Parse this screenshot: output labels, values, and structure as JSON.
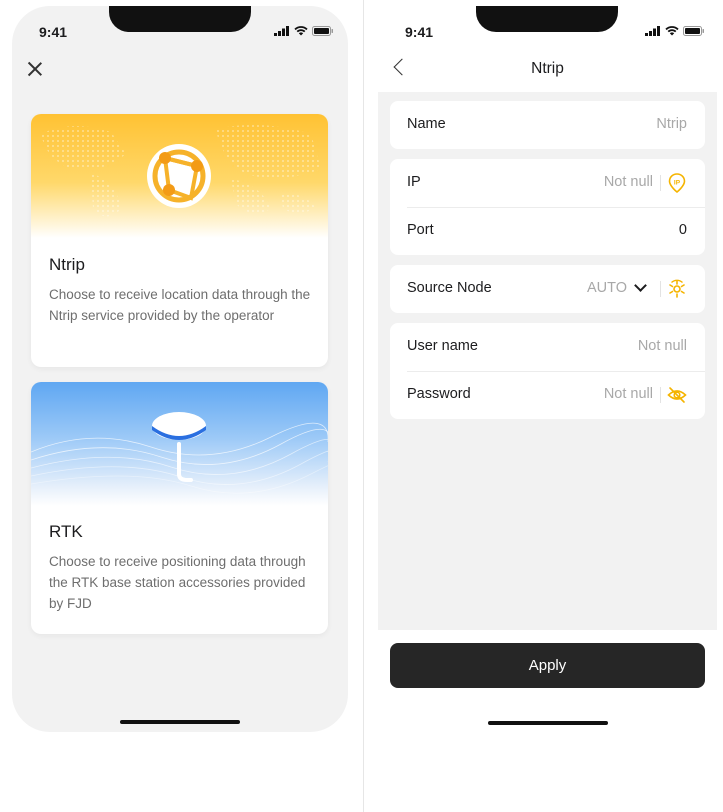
{
  "status_bar": {
    "time": "9:41"
  },
  "left_screen": {
    "cards": [
      {
        "title": "Ntrip",
        "description": "Choose to receive location data through the Ntrip service provided by the operator",
        "banner_icon": "globe-network-icon",
        "banner_color": "#ffc233"
      },
      {
        "title": "RTK",
        "description": "Choose to receive positioning data through the RTK base station accessories provided by FJD",
        "banner_icon": "rtk-antenna-icon",
        "banner_color": "#5fa7f2"
      }
    ]
  },
  "right_screen": {
    "nav_title": "Ntrip",
    "form": {
      "name": {
        "label": "Name",
        "value": "Ntrip"
      },
      "ip": {
        "label": "IP",
        "value": "Not null",
        "icon": "ip-location-icon"
      },
      "port": {
        "label": "Port",
        "value": "0"
      },
      "source_node": {
        "label": "Source Node",
        "value": "AUTO",
        "icon": "refresh-node-icon"
      },
      "username": {
        "label": "User name",
        "value": "Not null"
      },
      "password": {
        "label": "Password",
        "value": "Not null",
        "icon": "eye-off-icon"
      }
    },
    "apply_label": "Apply"
  },
  "colors": {
    "accent": "#f5b400",
    "button": "#262626",
    "background": "#f2f2f2"
  }
}
